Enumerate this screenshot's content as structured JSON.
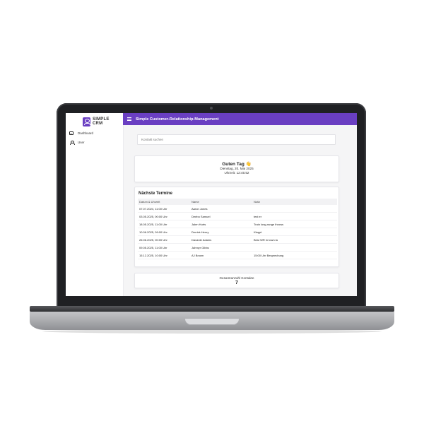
{
  "app": {
    "brand": [
      "SIMPLE",
      "CRM"
    ],
    "title": "Simple Customer-Relationship-Management",
    "accent_color": "#6a3fc2"
  },
  "sidebar": {
    "items": [
      {
        "label": "Dashboard",
        "icon": "dashboard-icon"
      },
      {
        "label": "User",
        "icon": "user-icon"
      }
    ]
  },
  "search": {
    "placeholder": "Kontakt suchen"
  },
  "greeting": {
    "title": "Guten Tag 👋",
    "date": "Dienstag, 20. Mai 2025",
    "time": "Uhrzeit: 12:45:52"
  },
  "appointments": {
    "title": "Nächste Termine",
    "columns": [
      "Datum & Uhrzeit",
      "Name",
      "Notiz"
    ],
    "rows": [
      [
        "07.07.2024, 11:00 Uhr",
        "Aaron Jones",
        ""
      ],
      [
        "03.05.2025, 00:00 Uhr",
        "Deebo Samuel",
        "test er"
      ],
      [
        "18.05.2025, 11:00 Uhr",
        "Jalen Hurts",
        "Train long-range throws"
      ],
      [
        "10.06.2025, 09:00 Uhr",
        "Derrick Henry",
        "Klappt"
      ],
      [
        "26.06.2025, 00:00 Uhr",
        "Davante Adams",
        "Best WR in town la"
      ],
      [
        "09.05.2025, 11:00 Uhr",
        "Jahmyr Gibbs",
        ""
      ],
      [
        "15.12.2025, 10:00 Uhr",
        "AJ Brown",
        "15:00 Uhr Besprechung"
      ]
    ]
  },
  "contacts": {
    "label": "Gesamtanzahl Kontakte",
    "value": "7"
  }
}
